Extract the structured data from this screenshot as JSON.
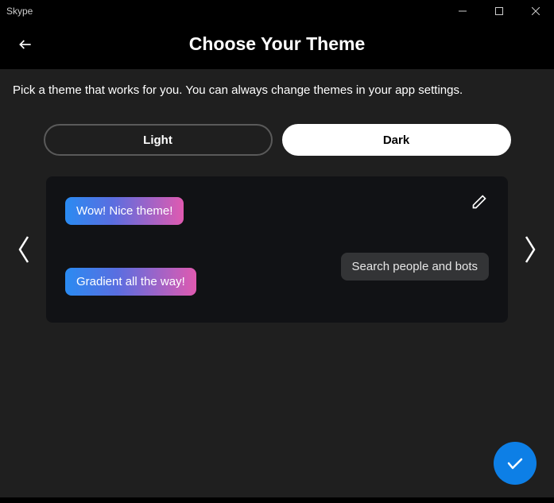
{
  "titlebar": {
    "app_name": "Skype"
  },
  "header": {
    "title": "Choose Your Theme"
  },
  "subtitle": "Pick a theme that works for you. You can always change themes in your app settings.",
  "segments": {
    "light": "Light",
    "dark": "Dark",
    "selected": "dark"
  },
  "preview": {
    "bubble1": "Wow! Nice theme!",
    "bubble2": "Gradient all the way!",
    "search_placeholder": "Search people and bots"
  }
}
